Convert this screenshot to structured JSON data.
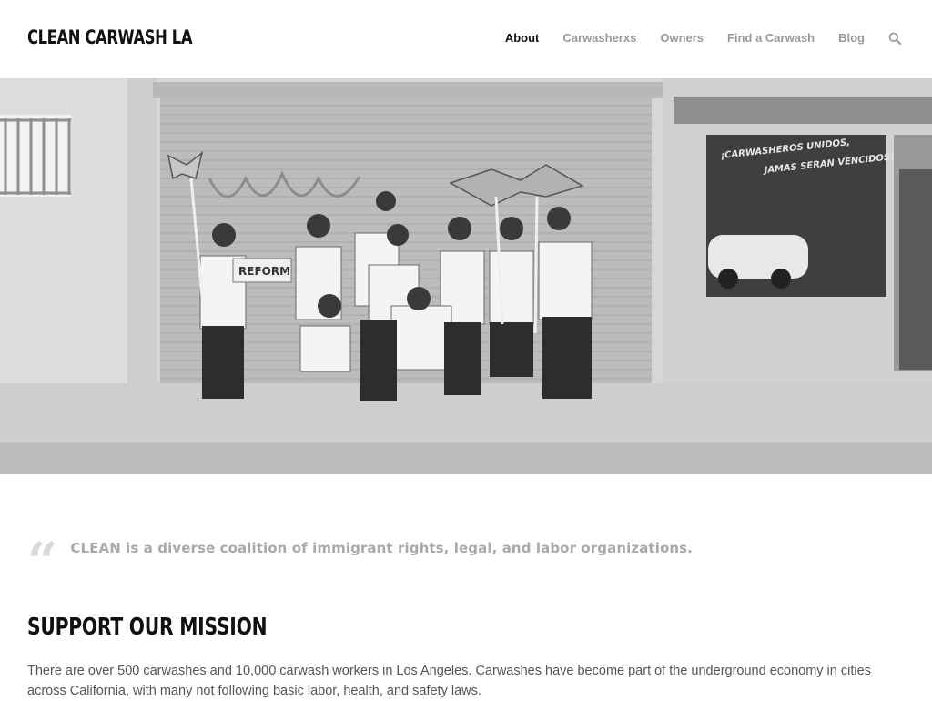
{
  "site": {
    "logo": "CLEAN CARWASH LA"
  },
  "nav": {
    "items": [
      {
        "label": "About",
        "active": true
      },
      {
        "label": "Carwasherxs",
        "active": false
      },
      {
        "label": "Owners",
        "active": false
      },
      {
        "label": "Find a Carwash",
        "active": false
      },
      {
        "label": "Blog",
        "active": false
      }
    ],
    "search_icon": "search-icon"
  },
  "hero": {
    "window_text_line1": "¡CARWASHEROS UNIDOS,",
    "window_text_line2": "JAMAS SERAN VENCIDOS!",
    "sign_text": "REFORM"
  },
  "quote": {
    "text": "CLEAN is a diverse coalition of immigrant rights, legal, and labor organizations."
  },
  "mission": {
    "title": "SUPPORT OUR MISSION",
    "body": "There are over 500 carwashes and 10,000 carwash workers in Los Angeles. Carwashes have become part of the underground economy in cities across California, with many not following basic labor, health, and safety laws."
  },
  "colors": {
    "text_dark": "#111111",
    "nav_inactive": "#9a9a9a",
    "quote_text": "#a9a9a9",
    "body_text": "#555555"
  }
}
